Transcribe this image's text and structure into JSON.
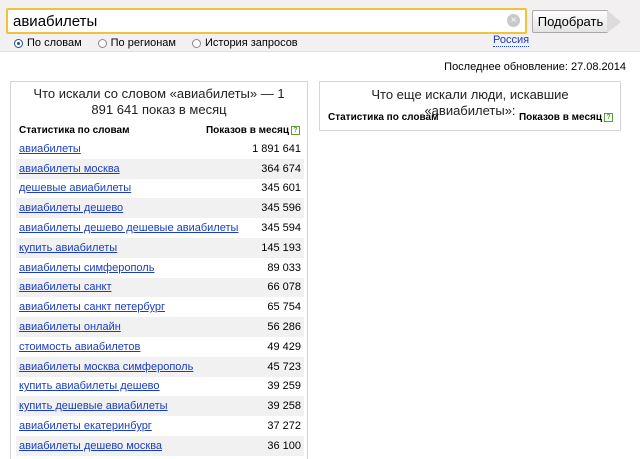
{
  "search": {
    "value": "авиабилеты",
    "clear_icon": "×"
  },
  "search_button": {
    "label": "Подобрать"
  },
  "modes": [
    {
      "label": "По словам",
      "selected": true
    },
    {
      "label": "По регионам",
      "selected": false
    },
    {
      "label": "История запросов",
      "selected": false
    }
  ],
  "region": "Россия",
  "last_updated": "Последнее обновление: 27.08.2014",
  "left_panel": {
    "title": "Что искали со словом «авиабилеты» — 1 891 641 показ в месяц",
    "col_words": "Статистика по словам",
    "col_shows": "Показов в месяц",
    "help_icon": "?",
    "rows": [
      {
        "query": "авиабилеты",
        "count": "1 891 641"
      },
      {
        "query": "авиабилеты москва",
        "count": "364 674"
      },
      {
        "query": "дешевые авиабилеты",
        "count": "345 601"
      },
      {
        "query": "авиабилеты дешево",
        "count": "345 596"
      },
      {
        "query": "авиабилеты дешево дешевые авиабилеты",
        "count": "345 594"
      },
      {
        "query": "купить авиабилеты",
        "count": "145 193"
      },
      {
        "query": "авиабилеты симферополь",
        "count": "89 033"
      },
      {
        "query": "авиабилеты санкт",
        "count": "66 078"
      },
      {
        "query": "авиабилеты санкт петербург",
        "count": "65 754"
      },
      {
        "query": "авиабилеты онлайн",
        "count": "56 286"
      },
      {
        "query": "стоимость авиабилетов",
        "count": "49 429"
      },
      {
        "query": "авиабилеты москва симферополь",
        "count": "45 723"
      },
      {
        "query": "купить авиабилеты дешево",
        "count": "39 259"
      },
      {
        "query": "купить дешевые авиабилеты",
        "count": "39 258"
      },
      {
        "query": "авиабилеты екатеринбург",
        "count": "37 272"
      },
      {
        "query": "авиабилеты дешево москва",
        "count": "36 100"
      },
      {
        "query": "",
        "count": ""
      }
    ]
  },
  "right_panel": {
    "title": "Что еще искали люди, искавшие «авиабилеты»:",
    "col_words": "Статистика по словам",
    "col_shows": "Показов в месяц",
    "help_icon": "?"
  },
  "colors": {
    "link": "#1a3dc1",
    "search_border": "#f1c33d",
    "help_icon": "#5a9f3a"
  }
}
